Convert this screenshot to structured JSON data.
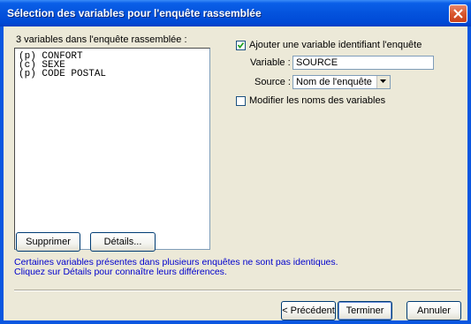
{
  "window": {
    "title": "Sélection des variables pour l'enquête rassemblée"
  },
  "left": {
    "list_label": "3 variables dans l'enquête rassemblée :",
    "list_items": [
      "(p) CONFORT",
      "(c) SEXE",
      "(p) CODE POSTAL"
    ],
    "delete_button": "Supprimer",
    "details_button": "Détails...",
    "info_line1": "Certaines variables présentes dans plusieurs enquêtes ne sont pas identiques.",
    "info_line2": "Cliquez sur Détails pour connaître leurs différences."
  },
  "right": {
    "add_variable_checkbox": {
      "label": "Ajouter une variable identifiant l'enquête",
      "checked": true
    },
    "variable_label": "Variable :",
    "variable_value": "SOURCE",
    "source_label": "Source :",
    "source_value": "Nom de l'enquête",
    "rename_checkbox": {
      "label": "Modifier les noms des variables",
      "checked": false
    }
  },
  "footer": {
    "previous_button": "< Précédent",
    "finish_button": "Terminer",
    "cancel_button": "Annuler"
  },
  "colors": {
    "title_bar": "#0453dd",
    "dialog_bg": "#ece9d8",
    "info_text": "#0000cc",
    "close_button": "#d9572e"
  }
}
